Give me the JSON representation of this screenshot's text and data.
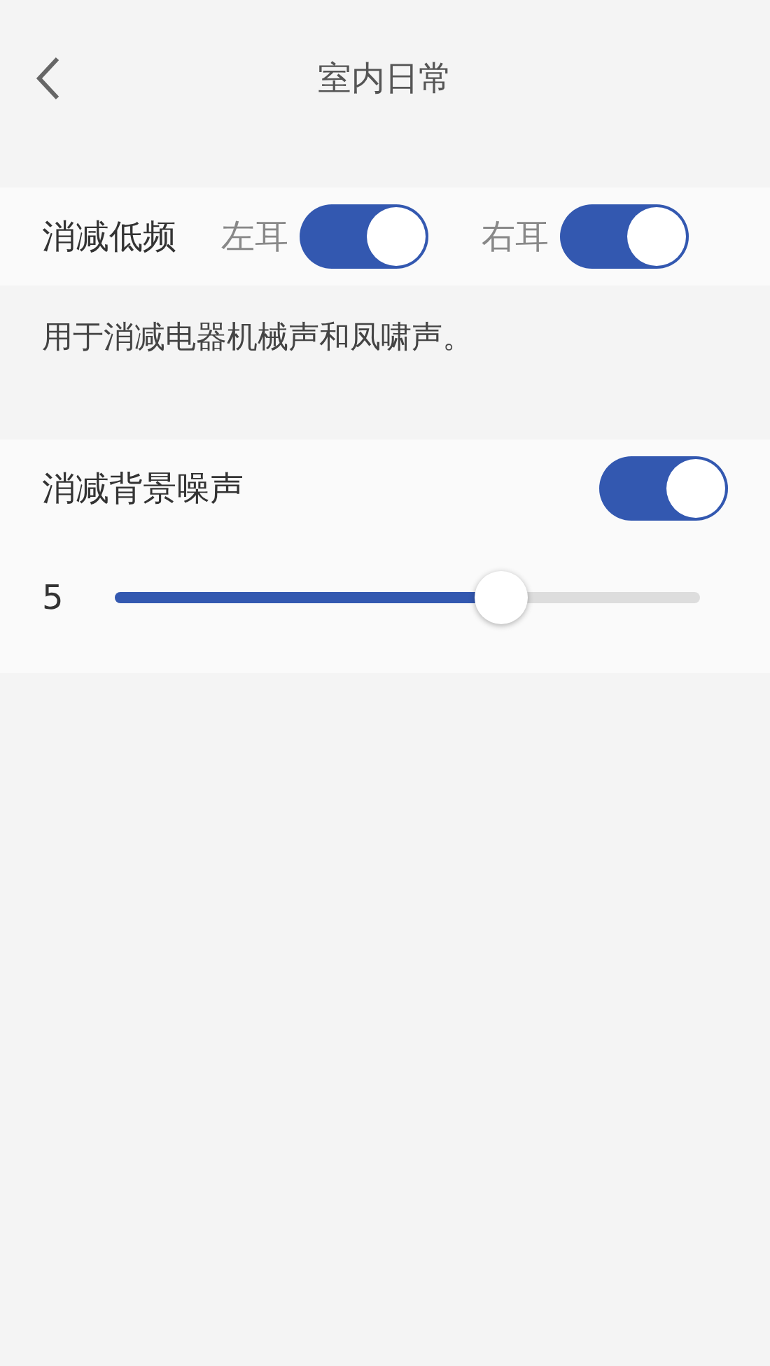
{
  "header": {
    "title": "室内日常"
  },
  "low_freq": {
    "label": "消减低频",
    "ears": [
      {
        "label": "左耳",
        "on": true
      },
      {
        "label": "右耳",
        "on": true
      }
    ]
  },
  "description": "用于消减电器机械声和凤啸声。",
  "background_noise": {
    "label": "消减背景噪声",
    "on": true,
    "value": "5",
    "level": 0.66
  }
}
